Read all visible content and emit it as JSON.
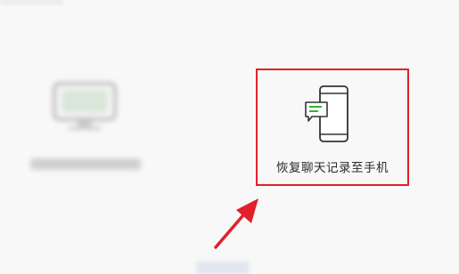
{
  "restore_option": {
    "label": "恢复聊天记录至手机"
  },
  "icons": {
    "backup": "monitor-icon",
    "restore": "phone-with-message-icon",
    "pointer": "red-arrow"
  },
  "colors": {
    "highlight_border": "#e0202a",
    "arrow": "#e0202a",
    "message_accent": "#1aad19"
  }
}
